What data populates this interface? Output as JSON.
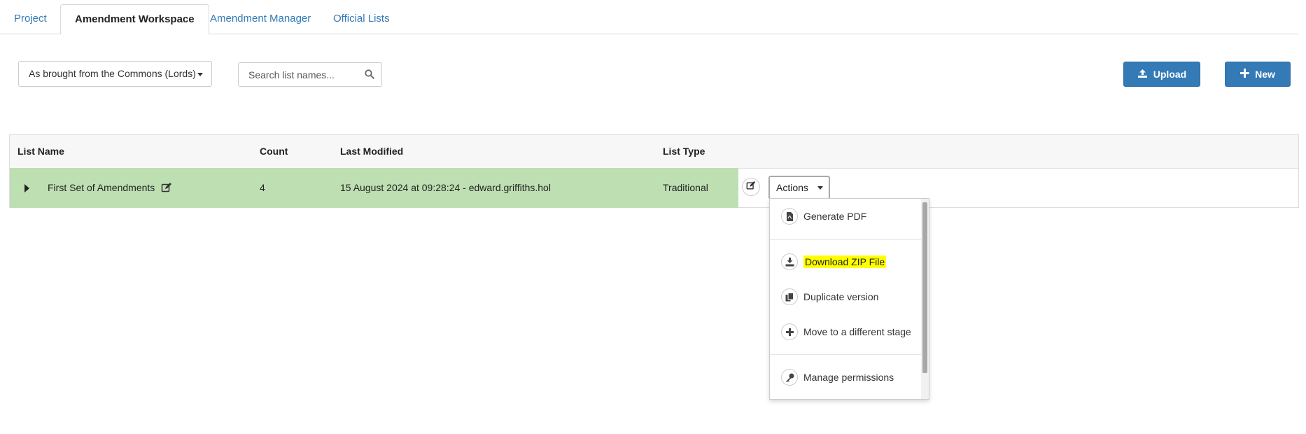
{
  "tabs": [
    {
      "label": "Project"
    },
    {
      "label": "Amendment Workspace"
    },
    {
      "label": "Amendment Manager"
    },
    {
      "label": "Official Lists"
    }
  ],
  "toolbar": {
    "stage_value": "As brought from the Commons (Lords)",
    "search_placeholder": "Search list names...",
    "upload_label": "Upload",
    "new_label": "New"
  },
  "table": {
    "headers": {
      "list_name": "List Name",
      "count": "Count",
      "last_modified": "Last Modified",
      "list_type": "List Type"
    },
    "rows": [
      {
        "name": "First Set of Amendments",
        "count": "4",
        "last_modified": "15 August 2024 at 09:28:24 - edward.griffiths.hol",
        "list_type": "Traditional",
        "actions_label": "Actions"
      }
    ]
  },
  "actions_menu": {
    "items": [
      {
        "label": "Generate PDF",
        "icon": "pdf-file-icon"
      },
      {
        "label": "Download ZIP File",
        "icon": "download-icon",
        "highlighted": true
      },
      {
        "label": "Duplicate version",
        "icon": "copy-icon"
      },
      {
        "label": "Move to a different stage",
        "icon": "plus-icon"
      },
      {
        "label": "Manage permissions",
        "icon": "key-icon"
      }
    ]
  },
  "colors": {
    "primary": "#337ab7",
    "selected_row": "#bedfb2",
    "highlight": "#ffff00"
  }
}
